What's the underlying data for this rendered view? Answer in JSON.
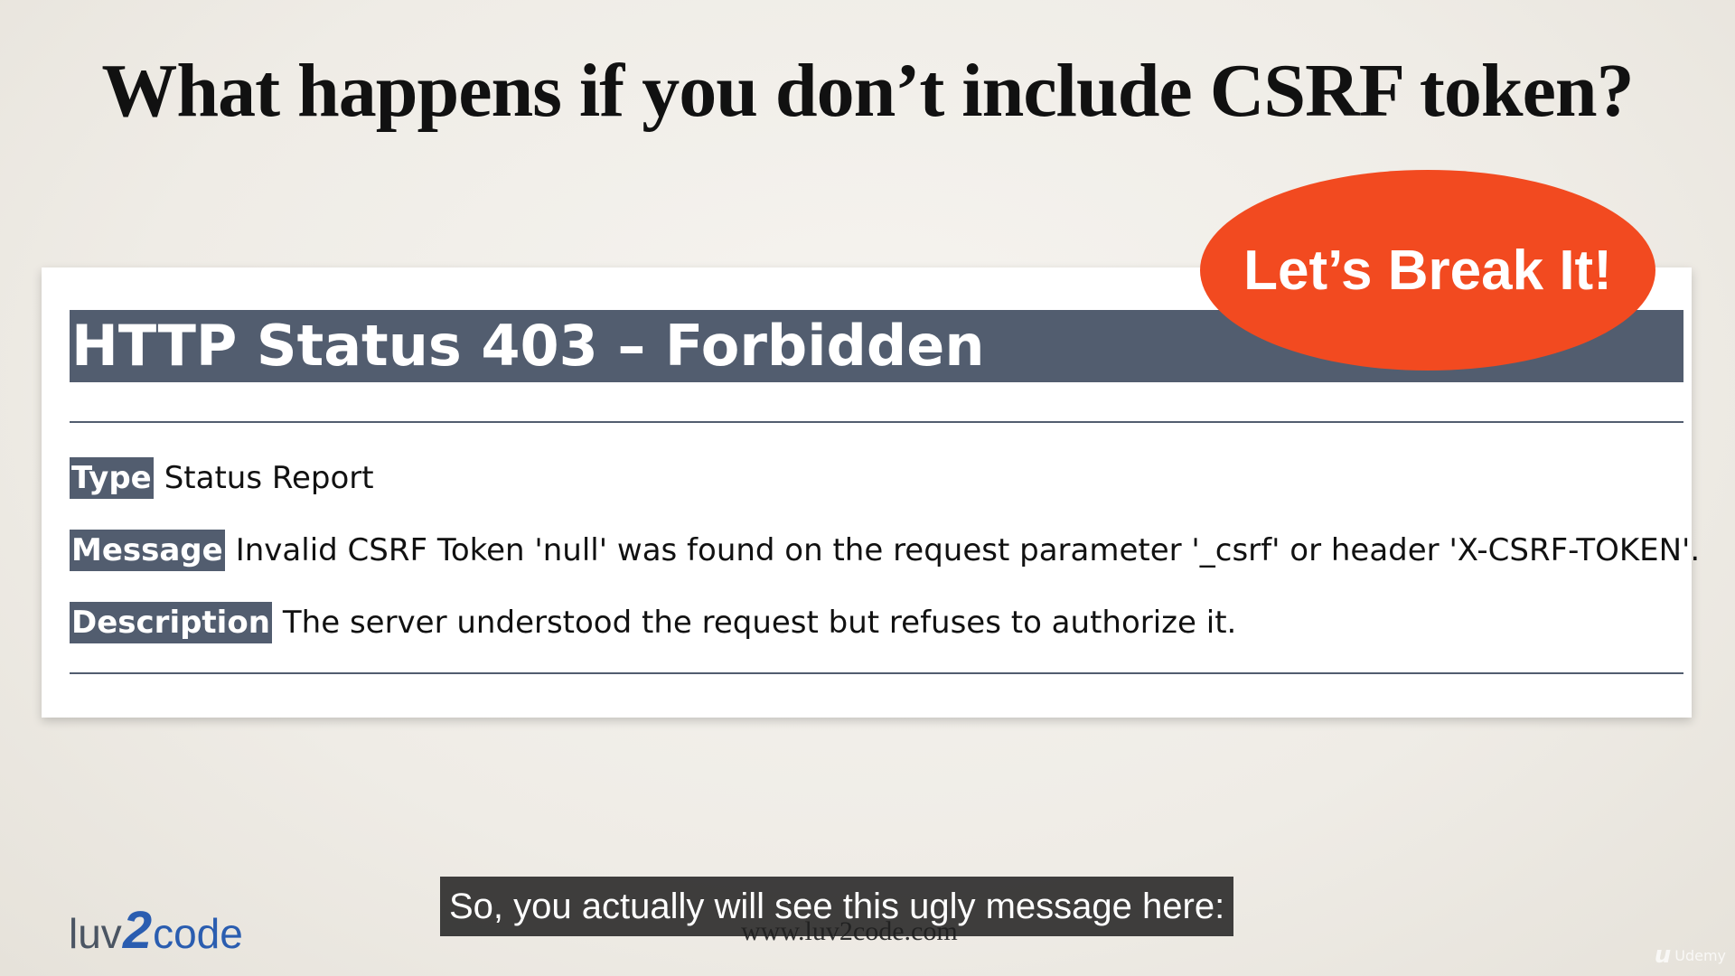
{
  "slide": {
    "title": "What happens if you don’t include CSRF token?"
  },
  "error_page": {
    "status_heading": "HTTP Status 403 – Forbidden",
    "fields": {
      "type": {
        "label": "Type",
        "value": "Status Report"
      },
      "message": {
        "label": "Message",
        "value": "Invalid CSRF Token 'null' was found on the request parameter '_csrf' or header 'X-CSRF-TOKEN'."
      },
      "description": {
        "label": "Description",
        "value": "The server understood the request but refuses to authorize it."
      }
    },
    "header_color": "#525d6f"
  },
  "badge": {
    "text": "Let’s Break It!",
    "color": "#f24a20"
  },
  "branding": {
    "logo_prefix": "luv",
    "logo_two": "2",
    "logo_suffix": "code",
    "website": "www.luv2code.com"
  },
  "subtitle": {
    "text": "So, you actually will see this ugly message here:"
  },
  "watermark": {
    "icon": "udemy-logo-icon",
    "text": "Udemy"
  }
}
